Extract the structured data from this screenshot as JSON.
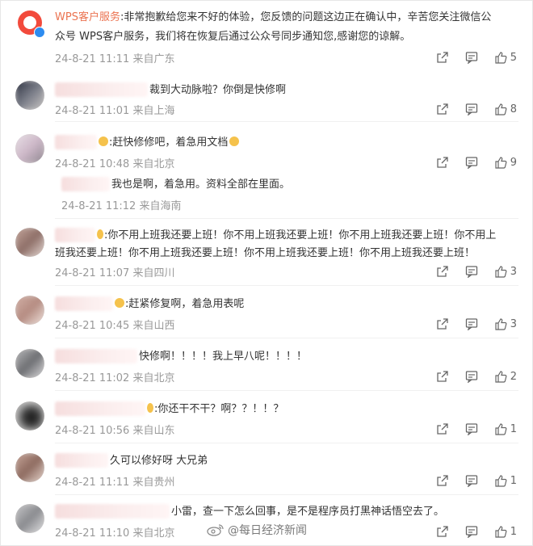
{
  "comments": [
    {
      "author": "WPS客户服务",
      "text_line1": ":非常抱歉给您来不好的体验，您反馈的问题这边正在确认中，辛苦您关注微信公",
      "text_line2": "众号 WPS客户服务，我们将在恢复后通过公众号同步通知您,感谢您的谅解。",
      "date": "24-8-21 11:11",
      "location": "来自广东",
      "likes": "5"
    },
    {
      "text": "裁到大动脉啦？你倒是快修啊",
      "date": "24-8-21 11:01",
      "location": "来自上海",
      "likes": "8"
    },
    {
      "text": ":赶快修修吧，着急用文档",
      "date": "24-8-21 10:48",
      "location": "来自北京",
      "likes": "9"
    },
    {
      "text": "我也是啊，着急用。资料全部在里面。",
      "date": "24-8-21 11:12",
      "location": "来自海南",
      "likes": ""
    },
    {
      "text_line1": ":你不用上班我还要上班！你不用上班我还要上班！你不用上班我还要上班！你不用上",
      "text_line2": "班我还要上班！你不用上班我还要上班！你不用上班我还要上班！你不用上班我还要上班！",
      "date": "24-8-21 11:07",
      "location": "来自四川",
      "likes": "3"
    },
    {
      "text": ":赶紧修复啊，着急用表呢",
      "date": "24-8-21 10:45",
      "location": "来自山西",
      "likes": "3"
    },
    {
      "text": "快修啊！！！！我上早八呢！！！！",
      "date": "24-8-21 11:02",
      "location": "来自北京",
      "likes": "2"
    },
    {
      "text": ":你还干不干？啊？？！！？",
      "date": "24-8-21 10:56",
      "location": "来自山东",
      "likes": "1"
    },
    {
      "text": "久可以修好呀 大兄弟",
      "date": "24-8-21 11:11",
      "location": "来自贵州",
      "likes": "1"
    },
    {
      "text": "小雷，查一下怎么回事，是不是程序员打黑神话悟空去了。",
      "date": "24-8-21 11:10",
      "location": "来自北京",
      "likes": "1"
    }
  ],
  "watermark": "@每日经济新闻",
  "colors": {
    "author": "#eb7350",
    "meta": "#999999",
    "text": "#333333",
    "wps_brand": "#f24a3c"
  },
  "icons": [
    "share-icon",
    "comment-icon",
    "like-icon"
  ]
}
